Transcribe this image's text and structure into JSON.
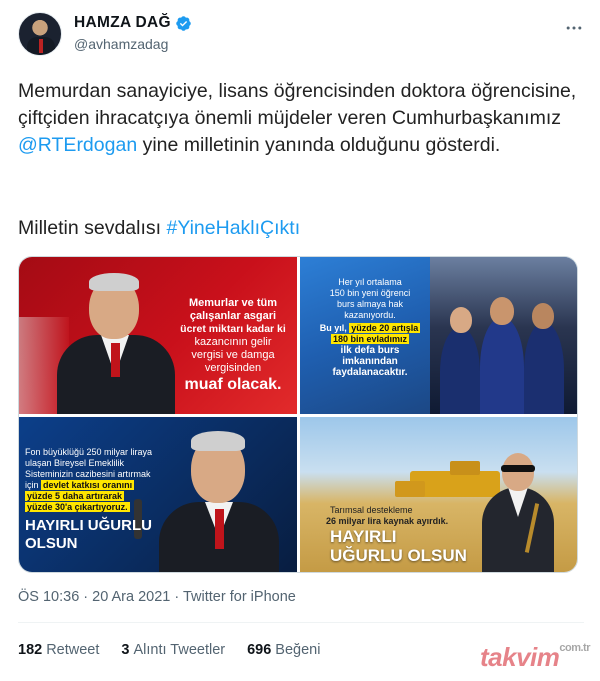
{
  "author": {
    "name": "HAMZA DAĞ",
    "handle": "@avhamzadag",
    "verified_icon": "verified-badge-icon",
    "more_icon": "more-horizontal-icon"
  },
  "tweet": {
    "text_before_mention": "Memurdan sanayiciye, lisans öğrencisinden doktora öğrencisine, çiftçiden ihracatçıya önemli müjdeler veren Cumhurbaşkanımız ",
    "mention": "@RTErdogan",
    "text_after_mention": " yine milletinin yanında olduğunu gösterdi.",
    "line2_text": "Milletin sevdalısı ",
    "hashtag": "#YineHaklıÇıktı"
  },
  "media": {
    "tile1": {
      "caption_line1": "Memurlar ve tüm",
      "caption_line2": "çalışanlar asgari",
      "caption_line3": "ücret miktarı kadar ki",
      "caption_line4": "kazancının gelir",
      "caption_line5": "vergisi ve damga",
      "caption_line6": "vergisinden",
      "caption_big": "muaf olacak."
    },
    "tile2": {
      "caption_line1": "Her yıl ortalama",
      "caption_line2": "150 bin yeni öğrenci",
      "caption_line3": "burs almaya hak",
      "caption_line4": "kazanıyordu.",
      "caption_hl_pre": "Bu yıl,",
      "caption_hl": "yüzde 20 artışla",
      "caption_hl2": "180 bin evladımız",
      "caption_line5": "ilk defa burs",
      "caption_line6": "imkanından",
      "caption_line7": "faydalanacaktır."
    },
    "tile3": {
      "caption_line1": "Fon büyüklüğü 250 milyar liraya",
      "caption_line2": "ulaşan Bireysel Emeklilik",
      "caption_line3": "Sisteminizin cazibesini artırmak",
      "caption_line4_pre": "için",
      "caption_hl1": "devlet katkısı oranını",
      "caption_hl2": "yüzde 5 daha artırarak",
      "caption_hl3": "yüzde 30'a çıkartıyoruz.",
      "caption_big1": "HAYIRLI UĞURLU",
      "caption_big2": "OLSUN"
    },
    "tile4": {
      "caption_line1": "Tarımsal destekleme",
      "caption_line2": "26 milyar lira kaynak ayırdık.",
      "caption_big1": "HAYIRLI",
      "caption_big2": "UĞURLU OLSUN"
    }
  },
  "meta": {
    "time": "ÖS 10:36",
    "sep": " · ",
    "date": "20 Ara 2021",
    "source": "Twitter for iPhone"
  },
  "stats": {
    "retweets_count": "182",
    "retweets_label": "Retweet",
    "quotes_count": "3",
    "quotes_label": "Alıntı Tweetler",
    "likes_count": "696",
    "likes_label": "Beğeni"
  },
  "watermark": {
    "text": "takvim",
    "suffix": "com.tr"
  },
  "colors": {
    "link": "#1d9bf0",
    "secondary_text": "#536471",
    "highlight": "#ffe600"
  }
}
